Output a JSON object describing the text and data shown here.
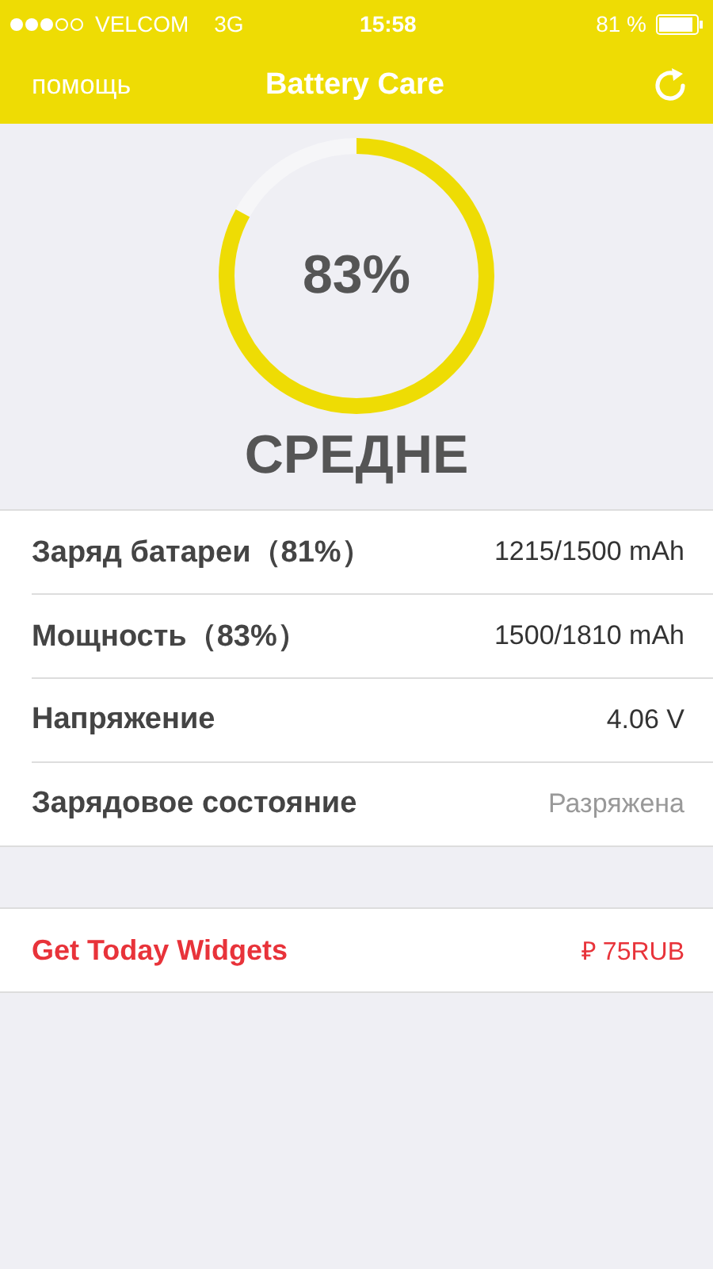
{
  "status_bar": {
    "carrier": "VELCOM",
    "network": "3G",
    "time": "15:58",
    "battery_text": "81 %"
  },
  "nav": {
    "left": "помощь",
    "title": "Battery Care"
  },
  "gauge": {
    "level": 0.83,
    "reading": "83%",
    "rating": "СРЕДНЕ"
  },
  "stats": [
    {
      "label": "Заряд батареи（81%）",
      "value": "1215/1500 mAh",
      "kind": "reading"
    },
    {
      "label": "Мощность（83%）",
      "value": "1500/1810 mAh",
      "kind": "reading"
    },
    {
      "label": "Напряжение",
      "value": "4.06 V",
      "kind": "reading"
    },
    {
      "label": "Зарядовое состояние",
      "value": "Разряжена",
      "kind": "status"
    }
  ],
  "offer": {
    "label": "Get Today Widgets",
    "price": "₽ 75RUB"
  }
}
